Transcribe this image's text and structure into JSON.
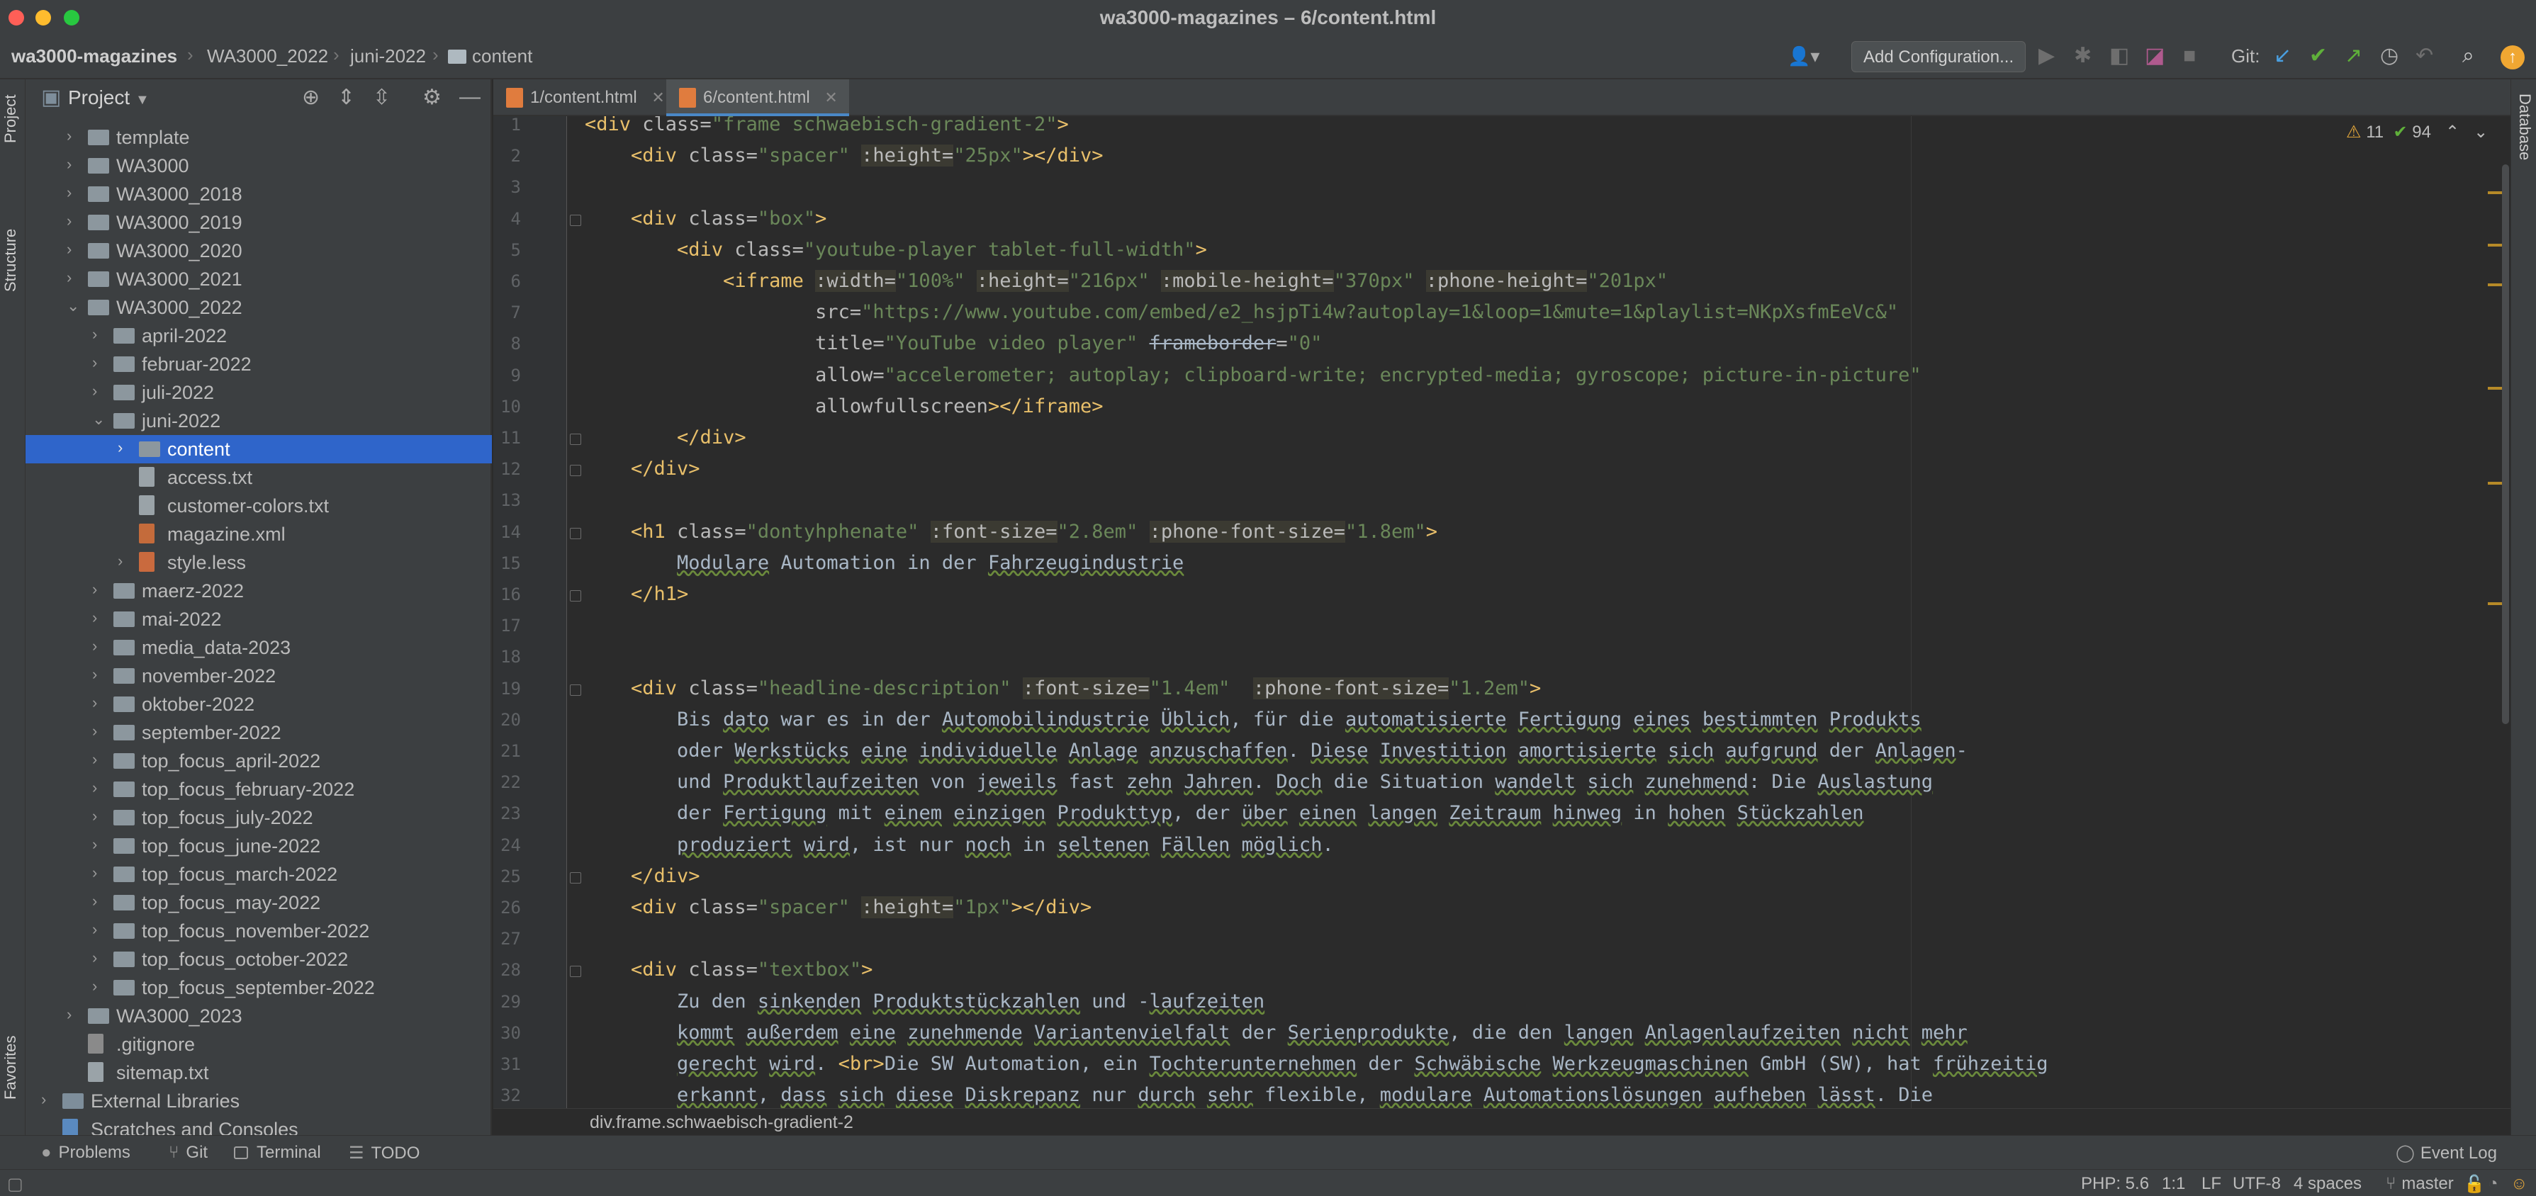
{
  "window": {
    "title": "wa3000-magazines – 6/content.html"
  },
  "navbar": {
    "breadcrumbs": [
      "wa3000-magazines",
      "WA3000_2022",
      "juni-2022",
      "content"
    ],
    "add_config_label": "Add Configuration...",
    "git_label": "Git:"
  },
  "left_strip": {
    "project_label": "Project",
    "structure_label": "Structure",
    "favorites_label": "Favorites"
  },
  "right_strip": {
    "database_label": "Database"
  },
  "project_panel": {
    "title": "Project",
    "items": [
      {
        "label": "template",
        "depth": 1,
        "type": "folder",
        "arrow": "›"
      },
      {
        "label": "WA3000",
        "depth": 1,
        "type": "folder",
        "arrow": "›"
      },
      {
        "label": "WA3000_2018",
        "depth": 1,
        "type": "folder",
        "arrow": "›"
      },
      {
        "label": "WA3000_2019",
        "depth": 1,
        "type": "folder",
        "arrow": "›"
      },
      {
        "label": "WA3000_2020",
        "depth": 1,
        "type": "folder",
        "arrow": "›"
      },
      {
        "label": "WA3000_2021",
        "depth": 1,
        "type": "folder",
        "arrow": "›"
      },
      {
        "label": "WA3000_2022",
        "depth": 1,
        "type": "folder",
        "arrow": "⌄"
      },
      {
        "label": "april-2022",
        "depth": 2,
        "type": "folder",
        "arrow": "›"
      },
      {
        "label": "februar-2022",
        "depth": 2,
        "type": "folder",
        "arrow": "›"
      },
      {
        "label": "juli-2022",
        "depth": 2,
        "type": "folder",
        "arrow": "›"
      },
      {
        "label": "juni-2022",
        "depth": 2,
        "type": "folder",
        "arrow": "⌄"
      },
      {
        "label": "content",
        "depth": 3,
        "type": "folder",
        "arrow": "›",
        "selected": true
      },
      {
        "label": "access.txt",
        "depth": 3,
        "type": "file",
        "arrow": ""
      },
      {
        "label": "customer-colors.txt",
        "depth": 3,
        "type": "file",
        "arrow": ""
      },
      {
        "label": "magazine.xml",
        "depth": 3,
        "type": "xml",
        "arrow": ""
      },
      {
        "label": "style.less",
        "depth": 3,
        "type": "less",
        "arrow": "›"
      },
      {
        "label": "maerz-2022",
        "depth": 2,
        "type": "folder",
        "arrow": "›"
      },
      {
        "label": "mai-2022",
        "depth": 2,
        "type": "folder",
        "arrow": "›"
      },
      {
        "label": "media_data-2023",
        "depth": 2,
        "type": "folder",
        "arrow": "›"
      },
      {
        "label": "november-2022",
        "depth": 2,
        "type": "folder",
        "arrow": "›"
      },
      {
        "label": "oktober-2022",
        "depth": 2,
        "type": "folder",
        "arrow": "›"
      },
      {
        "label": "september-2022",
        "depth": 2,
        "type": "folder",
        "arrow": "›"
      },
      {
        "label": "top_focus_april-2022",
        "depth": 2,
        "type": "folder",
        "arrow": "›"
      },
      {
        "label": "top_focus_february-2022",
        "depth": 2,
        "type": "folder",
        "arrow": "›"
      },
      {
        "label": "top_focus_july-2022",
        "depth": 2,
        "type": "folder",
        "arrow": "›"
      },
      {
        "label": "top_focus_june-2022",
        "depth": 2,
        "type": "folder",
        "arrow": "›"
      },
      {
        "label": "top_focus_march-2022",
        "depth": 2,
        "type": "folder",
        "arrow": "›"
      },
      {
        "label": "top_focus_may-2022",
        "depth": 2,
        "type": "folder",
        "arrow": "›"
      },
      {
        "label": "top_focus_november-2022",
        "depth": 2,
        "type": "folder",
        "arrow": "›"
      },
      {
        "label": "top_focus_october-2022",
        "depth": 2,
        "type": "folder",
        "arrow": "›"
      },
      {
        "label": "top_focus_september-2022",
        "depth": 2,
        "type": "folder",
        "arrow": "›"
      },
      {
        "label": "WA3000_2023",
        "depth": 1,
        "type": "folder",
        "arrow": "›"
      },
      {
        "label": ".gitignore",
        "depth": 1,
        "type": "git",
        "arrow": ""
      },
      {
        "label": "sitemap.txt",
        "depth": 1,
        "type": "file",
        "arrow": ""
      },
      {
        "label": "External Libraries",
        "depth": 0,
        "type": "ext",
        "arrow": "›"
      },
      {
        "label": "Scratches and Consoles",
        "depth": 0,
        "type": "scratch",
        "arrow": ""
      }
    ]
  },
  "tabs": [
    {
      "label": "1/content.html",
      "active": false
    },
    {
      "label": "6/content.html",
      "active": true
    }
  ],
  "inspection": {
    "warnings": "11",
    "ok": "94"
  },
  "code_lines": [
    [
      [
        "tg",
        "<div "
      ],
      [
        "at",
        "class="
      ],
      [
        "sv",
        "\"frame schwaebisch-gradient-2\""
      ],
      [
        "tg",
        ">"
      ]
    ],
    [
      [
        "tx",
        "    "
      ],
      [
        "tg",
        "<div "
      ],
      [
        "at",
        "class="
      ],
      [
        "sv",
        "\"spacer\""
      ],
      [
        "tx",
        " "
      ],
      [
        "vu",
        ":height="
      ],
      [
        "sv",
        "\"25px\""
      ],
      [
        "tg",
        "></div>"
      ]
    ],
    [],
    [
      [
        "tx",
        "    "
      ],
      [
        "tg",
        "<div "
      ],
      [
        "at",
        "class="
      ],
      [
        "sv",
        "\"box\""
      ],
      [
        "tg",
        ">"
      ]
    ],
    [
      [
        "tx",
        "        "
      ],
      [
        "tg",
        "<div "
      ],
      [
        "at",
        "class="
      ],
      [
        "sv",
        "\"youtube-player tablet-full-width\""
      ],
      [
        "tg",
        ">"
      ]
    ],
    [
      [
        "tx",
        "            "
      ],
      [
        "tg",
        "<iframe "
      ],
      [
        "vu",
        ":width="
      ],
      [
        "sv",
        "\"100%\""
      ],
      [
        "tx",
        " "
      ],
      [
        "vu",
        ":height="
      ],
      [
        "sv",
        "\"216px\""
      ],
      [
        "tx",
        " "
      ],
      [
        "vu",
        ":mobile-height="
      ],
      [
        "sv",
        "\"370px\""
      ],
      [
        "tx",
        " "
      ],
      [
        "vu",
        ":phone-height="
      ],
      [
        "sv",
        "\"201px\""
      ]
    ],
    [
      [
        "tx",
        "                    "
      ],
      [
        "at",
        "src="
      ],
      [
        "sv",
        "\"https://www.youtube.com/embed/e2_hsjpTi4w?autoplay=1&loop=1&mute=1&playlist=NKpXsfmEeVc&\""
      ]
    ],
    [
      [
        "tx",
        "                    "
      ],
      [
        "at",
        "title="
      ],
      [
        "sv",
        "\"YouTube video player\""
      ],
      [
        "tx",
        " "
      ],
      [
        "st",
        "frameborder"
      ],
      [
        "at",
        "="
      ],
      [
        "sv",
        "\"0\""
      ]
    ],
    [
      [
        "tx",
        "                    "
      ],
      [
        "at",
        "allow="
      ],
      [
        "sv",
        "\"accelerometer; autoplay; clipboard-write; encrypted-media; gyroscope; picture-in-picture\""
      ]
    ],
    [
      [
        "tx",
        "                    "
      ],
      [
        "at",
        "allowfullscreen"
      ],
      [
        "tg",
        "></iframe>"
      ]
    ],
    [
      [
        "tx",
        "        "
      ],
      [
        "tg",
        "</div>"
      ]
    ],
    [
      [
        "tx",
        "    "
      ],
      [
        "tg",
        "</div>"
      ]
    ],
    [],
    [
      [
        "tx",
        "    "
      ],
      [
        "tg",
        "<h1 "
      ],
      [
        "at",
        "class="
      ],
      [
        "sv",
        "\"dontyhphenate\""
      ],
      [
        "tx",
        " "
      ],
      [
        "vu",
        ":font-size="
      ],
      [
        "sv",
        "\"2.8em\""
      ],
      [
        "tx",
        " "
      ],
      [
        "vu",
        ":phone-font-size="
      ],
      [
        "sv",
        "\"1.8em\""
      ],
      [
        "tg",
        ">"
      ]
    ],
    [
      [
        "tx",
        "        "
      ],
      [
        "wv",
        "Modulare"
      ],
      [
        "tx",
        " Automation in der "
      ],
      [
        "wv",
        "Fahrzeugindustrie"
      ]
    ],
    [
      [
        "tx",
        "    "
      ],
      [
        "tg",
        "</h1>"
      ]
    ],
    [],
    [],
    [
      [
        "tx",
        "    "
      ],
      [
        "tg",
        "<div "
      ],
      [
        "at",
        "class="
      ],
      [
        "sv",
        "\"headline-description\""
      ],
      [
        "tx",
        " "
      ],
      [
        "vu",
        ":font-size="
      ],
      [
        "sv",
        "\"1.4em\""
      ],
      [
        "tx",
        "  "
      ],
      [
        "vu",
        ":phone-font-size="
      ],
      [
        "sv",
        "\"1.2em\""
      ],
      [
        "tg",
        ">"
      ]
    ],
    [
      [
        "tx",
        "        Bis "
      ],
      [
        "wv",
        "dato"
      ],
      [
        "tx",
        " war es in der "
      ],
      [
        "wv",
        "Automobilindustrie"
      ],
      [
        "tx",
        " "
      ],
      [
        "wv",
        "Üblich"
      ],
      [
        "tx",
        ", für die "
      ],
      [
        "wv",
        "automatisierte"
      ],
      [
        "tx",
        " "
      ],
      [
        "wv",
        "Fertigung"
      ],
      [
        "tx",
        " "
      ],
      [
        "wv",
        "eines"
      ],
      [
        "tx",
        " "
      ],
      [
        "wv",
        "bestimmten"
      ],
      [
        "tx",
        " "
      ],
      [
        "wv",
        "Produkts"
      ]
    ],
    [
      [
        "tx",
        "        oder "
      ],
      [
        "wv",
        "Werkstücks"
      ],
      [
        "tx",
        " "
      ],
      [
        "wv",
        "eine"
      ],
      [
        "tx",
        " "
      ],
      [
        "wv",
        "individuelle"
      ],
      [
        "tx",
        " "
      ],
      [
        "wv",
        "Anlage"
      ],
      [
        "tx",
        " "
      ],
      [
        "wv",
        "anzuschaffen"
      ],
      [
        "tx",
        ". "
      ],
      [
        "wv",
        "Diese"
      ],
      [
        "tx",
        " "
      ],
      [
        "wv",
        "Investition"
      ],
      [
        "tx",
        " "
      ],
      [
        "wv",
        "amortisierte"
      ],
      [
        "tx",
        " "
      ],
      [
        "wv",
        "sich"
      ],
      [
        "tx",
        " "
      ],
      [
        "wv",
        "aufgrund"
      ],
      [
        "tx",
        " der "
      ],
      [
        "wv",
        "Anlagen"
      ],
      [
        "tx",
        "-"
      ]
    ],
    [
      [
        "tx",
        "        und "
      ],
      [
        "wv",
        "Produktlaufzeiten"
      ],
      [
        "tx",
        " von "
      ],
      [
        "wv",
        "jeweils"
      ],
      [
        "tx",
        " fast "
      ],
      [
        "wv",
        "zehn"
      ],
      [
        "tx",
        " "
      ],
      [
        "wv",
        "Jahren"
      ],
      [
        "tx",
        ". "
      ],
      [
        "wv",
        "Doch"
      ],
      [
        "tx",
        " die Situation "
      ],
      [
        "wv",
        "wandelt"
      ],
      [
        "tx",
        " "
      ],
      [
        "wv",
        "sich"
      ],
      [
        "tx",
        " "
      ],
      [
        "wv",
        "zunehmend"
      ],
      [
        "tx",
        ": Die "
      ],
      [
        "wv",
        "Auslastung"
      ]
    ],
    [
      [
        "tx",
        "        der "
      ],
      [
        "wv",
        "Fertigung"
      ],
      [
        "tx",
        " mit "
      ],
      [
        "wv",
        "einem"
      ],
      [
        "tx",
        " "
      ],
      [
        "wv",
        "einzigen"
      ],
      [
        "tx",
        " "
      ],
      [
        "wv",
        "Produkttyp"
      ],
      [
        "tx",
        ", der "
      ],
      [
        "wv",
        "über"
      ],
      [
        "tx",
        " "
      ],
      [
        "wv",
        "einen"
      ],
      [
        "tx",
        " "
      ],
      [
        "wv",
        "langen"
      ],
      [
        "tx",
        " "
      ],
      [
        "wv",
        "Zeitraum"
      ],
      [
        "tx",
        " "
      ],
      [
        "wv",
        "hinweg"
      ],
      [
        "tx",
        " in "
      ],
      [
        "wv",
        "hohen"
      ],
      [
        "tx",
        " "
      ],
      [
        "wv",
        "Stückzahlen"
      ]
    ],
    [
      [
        "tx",
        "        "
      ],
      [
        "wv",
        "produziert"
      ],
      [
        "tx",
        " "
      ],
      [
        "wv",
        "wird"
      ],
      [
        "tx",
        ", ist nur "
      ],
      [
        "wv",
        "noch"
      ],
      [
        "tx",
        " in "
      ],
      [
        "wv",
        "seltenen"
      ],
      [
        "tx",
        " "
      ],
      [
        "wv",
        "Fällen"
      ],
      [
        "tx",
        " "
      ],
      [
        "wv",
        "möglich"
      ],
      [
        "tx",
        "."
      ]
    ],
    [
      [
        "tx",
        "    "
      ],
      [
        "tg",
        "</div>"
      ]
    ],
    [
      [
        "tx",
        "    "
      ],
      [
        "tg",
        "<div "
      ],
      [
        "at",
        "class="
      ],
      [
        "sv",
        "\"spacer\""
      ],
      [
        "tx",
        " "
      ],
      [
        "vu",
        ":height="
      ],
      [
        "sv",
        "\"1px\""
      ],
      [
        "tg",
        "></div>"
      ]
    ],
    [],
    [
      [
        "tx",
        "    "
      ],
      [
        "tg",
        "<div "
      ],
      [
        "at",
        "class="
      ],
      [
        "sv",
        "\"textbox\""
      ],
      [
        "tg",
        ">"
      ]
    ],
    [
      [
        "tx",
        "        Zu den "
      ],
      [
        "wv",
        "sinkenden"
      ],
      [
        "tx",
        " "
      ],
      [
        "wv",
        "Produktstückzahlen"
      ],
      [
        "tx",
        " und -"
      ],
      [
        "wv",
        "laufzeiten"
      ]
    ],
    [
      [
        "tx",
        "        "
      ],
      [
        "wv",
        "kommt"
      ],
      [
        "tx",
        " "
      ],
      [
        "wv",
        "außerdem"
      ],
      [
        "tx",
        " "
      ],
      [
        "wv",
        "eine"
      ],
      [
        "tx",
        " "
      ],
      [
        "wv",
        "zunehmende"
      ],
      [
        "tx",
        " "
      ],
      [
        "wv",
        "Variantenvielfalt"
      ],
      [
        "tx",
        " der "
      ],
      [
        "wv",
        "Serienprodukte"
      ],
      [
        "tx",
        ", die den "
      ],
      [
        "wv",
        "langen"
      ],
      [
        "tx",
        " "
      ],
      [
        "wv",
        "Anlagenlaufzeiten"
      ],
      [
        "tx",
        " "
      ],
      [
        "wv",
        "nicht"
      ],
      [
        "tx",
        " "
      ],
      [
        "wv",
        "mehr"
      ]
    ],
    [
      [
        "tx",
        "        "
      ],
      [
        "wv",
        "gerecht"
      ],
      [
        "tx",
        " "
      ],
      [
        "wv",
        "wird"
      ],
      [
        "tx",
        ". "
      ],
      [
        "tg",
        "<br>"
      ],
      [
        "tx",
        "Die SW Automation, ein "
      ],
      [
        "wv",
        "Tochterunternehmen"
      ],
      [
        "tx",
        " der "
      ],
      [
        "wv",
        "Schwäbische"
      ],
      [
        "tx",
        " "
      ],
      [
        "wv",
        "Werkzeugmaschinen"
      ],
      [
        "tx",
        " GmbH (SW), hat "
      ],
      [
        "wv",
        "frühzeitig"
      ]
    ],
    [
      [
        "tx",
        "        "
      ],
      [
        "wv",
        "erkannt"
      ],
      [
        "tx",
        ", "
      ],
      [
        "wv",
        "dass"
      ],
      [
        "tx",
        " "
      ],
      [
        "wv",
        "sich"
      ],
      [
        "tx",
        " "
      ],
      [
        "wv",
        "diese"
      ],
      [
        "tx",
        " "
      ],
      [
        "wv",
        "Diskrepanz"
      ],
      [
        "tx",
        " nur "
      ],
      [
        "wv",
        "durch"
      ],
      [
        "tx",
        " "
      ],
      [
        "wv",
        "sehr"
      ],
      [
        "tx",
        " flexible, "
      ],
      [
        "wv",
        "modulare"
      ],
      [
        "tx",
        " "
      ],
      [
        "wv",
        "Automationslösungen"
      ],
      [
        "tx",
        " "
      ],
      [
        "wv",
        "aufheben"
      ],
      [
        "tx",
        " "
      ],
      [
        "wv",
        "lässt"
      ],
      [
        "tx",
        ". Die"
      ]
    ]
  ],
  "editor_breadcrumb": "div.frame.schwaebisch-gradient-2",
  "tool_windows": [
    "Problems",
    "Git",
    "Terminal",
    "TODO"
  ],
  "event_log_label": "Event Log",
  "status": {
    "php": "PHP: 5.6",
    "position": "1:1",
    "line_sep": "LF",
    "encoding": "UTF-8",
    "indent": "4 spaces",
    "branch": "master"
  }
}
